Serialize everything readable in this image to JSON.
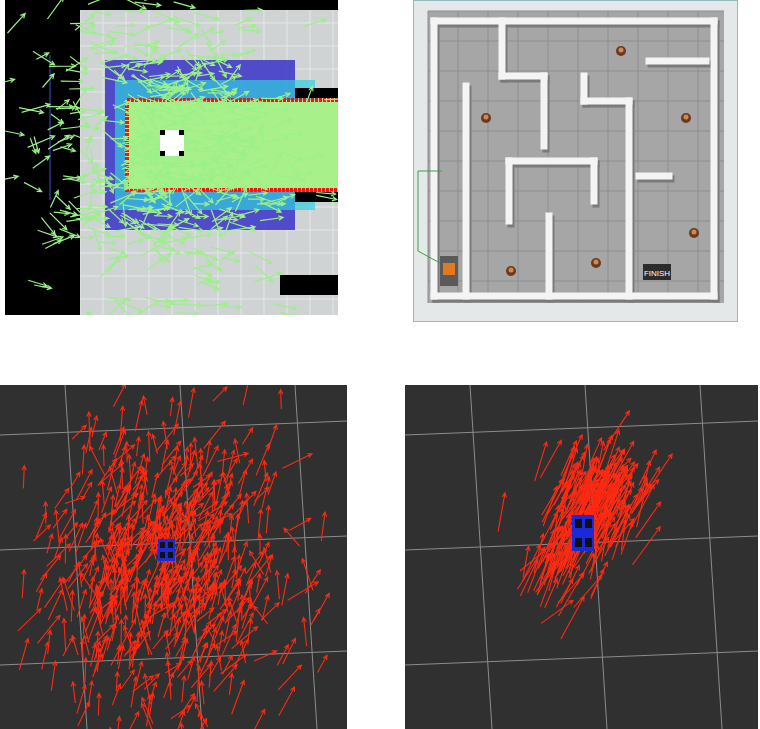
{
  "panels": [
    {
      "kind": "map-cloud",
      "color": "#9cf08a"
    },
    {
      "kind": "maze",
      "finish_label": "FINISH"
    },
    {
      "kind": "spread-cloud",
      "color": "#ff2a12"
    },
    {
      "kind": "converged-cloud",
      "color": "#ff2a12"
    }
  ]
}
